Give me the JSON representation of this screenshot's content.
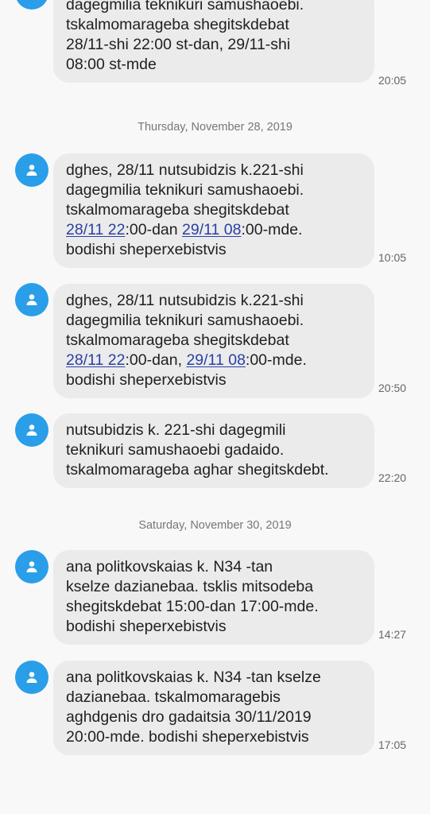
{
  "messages": [
    {
      "segments": [
        [
          {
            "t": "dagegmilia teknikuri samushaoebi."
          }
        ],
        [
          {
            "t": "tskalmomarageba shegitskdebat"
          }
        ],
        [
          {
            "t": "28/11-shi 22:00 st-dan, 29/11-shi"
          }
        ],
        [
          {
            "t": "08:00 st-mde"
          }
        ]
      ],
      "time": "20:05"
    },
    {
      "segments": [
        [
          {
            "t": "dghes, 28/11 nutsubidzis k.221-shi"
          }
        ],
        [
          {
            "t": "dagegmilia teknikuri samushaoebi."
          }
        ],
        [
          {
            "t": "tskalmomarageba shegitskdebat"
          }
        ],
        [
          {
            "t": "28/11 22",
            "link": true
          },
          {
            "t": ":00-dan "
          },
          {
            "t": "29/11 08",
            "link": true
          },
          {
            "t": ":00-mde."
          }
        ],
        [
          {
            "t": "bodishi sheperxebistvis"
          }
        ]
      ],
      "time": "10:05"
    },
    {
      "segments": [
        [
          {
            "t": "dghes, 28/11 nutsubidzis k.221-shi"
          }
        ],
        [
          {
            "t": "dagegmilia teknikuri samushaoebi."
          }
        ],
        [
          {
            "t": "tskalmomarageba shegitskdebat"
          }
        ],
        [
          {
            "t": "28/11 22",
            "link": true
          },
          {
            "t": ":00-dan, "
          },
          {
            "t": "29/11 08",
            "link": true
          },
          {
            "t": ":00-mde."
          }
        ],
        [
          {
            "t": "bodishi sheperxebistvis"
          }
        ]
      ],
      "time": "20:50"
    },
    {
      "segments": [
        [
          {
            "t": "nutsubidzis k. 221-shi dagegmili"
          }
        ],
        [
          {
            "t": "teknikuri samushaoebi gadaido."
          }
        ],
        [
          {
            "t": "tskalmomarageba aghar shegitskdebt."
          }
        ]
      ],
      "time": "22:20"
    },
    {
      "segments": [
        [
          {
            "t": "ana politkovskaias k. N34 -tan"
          }
        ],
        [
          {
            "t": "kselze dazianebaa. tsklis mitsodeba"
          }
        ],
        [
          {
            "t": "shegitskdebat 15:00-dan 17:00-mde."
          }
        ],
        [
          {
            "t": "bodishi sheperxebistvis"
          }
        ]
      ],
      "time": "14:27"
    },
    {
      "segments": [
        [
          {
            "t": "ana politkovskaias k. N34 -tan kselze"
          }
        ],
        [
          {
            "t": "dazianebaa. tskalmomaragebis"
          }
        ],
        [
          {
            "t": "aghdgenis dro gadaitsia 30/11/2019"
          }
        ],
        [
          {
            "t": "20:00-mde. bodishi sheperxebistvis"
          }
        ]
      ],
      "time": "17:05"
    }
  ],
  "date_separators": [
    "Thursday, November 28, 2019",
    "Saturday, November 30, 2019"
  ],
  "icons": {
    "avatar": "person-icon"
  },
  "colors": {
    "avatar_bg": "#2a9ee8",
    "bubble_bg": "#ebebeb",
    "link": "#2a3fa6"
  }
}
